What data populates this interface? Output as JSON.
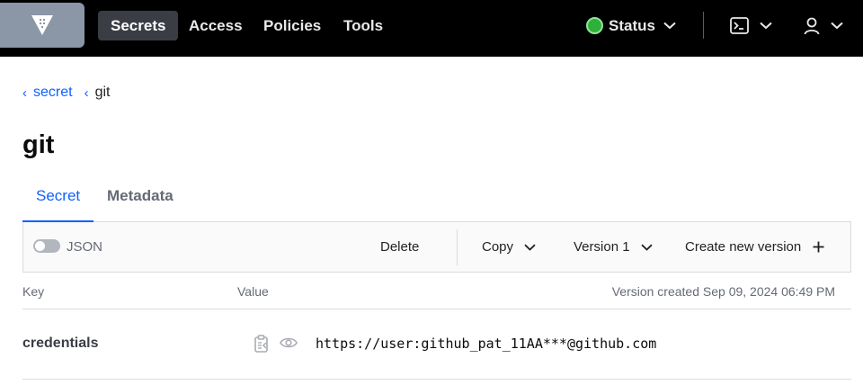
{
  "nav": {
    "items": [
      {
        "label": "Secrets",
        "active": true
      },
      {
        "label": "Access",
        "active": false
      },
      {
        "label": "Policies",
        "active": false
      },
      {
        "label": "Tools",
        "active": false
      }
    ],
    "status_label": "Status",
    "status_color": "#2eb039",
    "logo_icon": "vault-logo-icon",
    "console_icon": "terminal-icon",
    "user_icon": "user-icon"
  },
  "breadcrumb": {
    "parent": "secret",
    "current": "git"
  },
  "page": {
    "title": "git"
  },
  "tabs": [
    {
      "label": "Secret",
      "active": true
    },
    {
      "label": "Metadata",
      "active": false
    }
  ],
  "toolbar": {
    "json_toggle_label": "JSON",
    "json_toggle_on": false,
    "delete_label": "Delete",
    "copy_label": "Copy",
    "version_label": "Version 1",
    "create_version_label": "Create new version"
  },
  "table": {
    "key_header": "Key",
    "value_header": "Value",
    "version_created": "Version created Sep 09, 2024 06:49 PM",
    "rows": [
      {
        "key": "credentials",
        "value": "https://user:github_pat_11AA***@github.com"
      }
    ]
  },
  "colors": {
    "accent": "#1060ff",
    "nav_bg": "#000000"
  }
}
